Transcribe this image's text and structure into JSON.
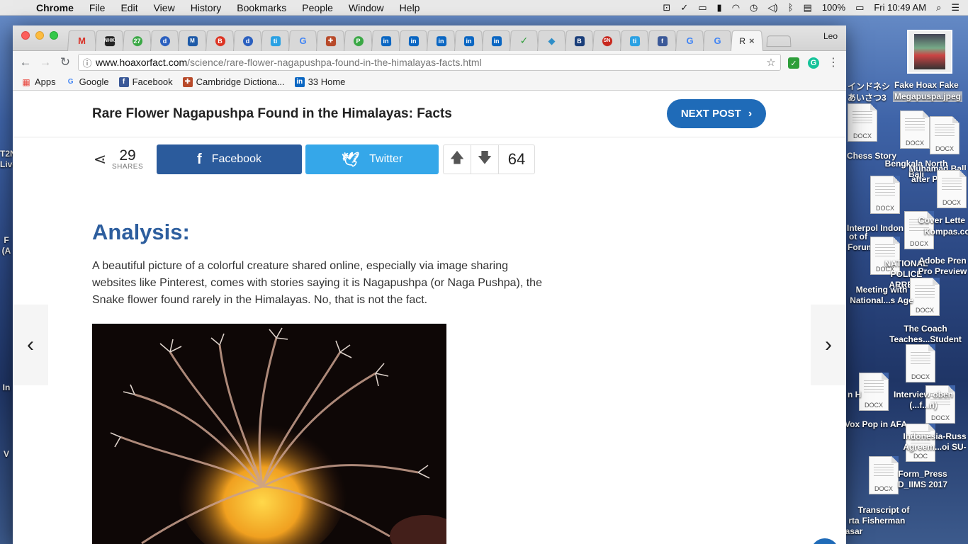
{
  "menubar": {
    "app": "Chrome",
    "menus": [
      "File",
      "Edit",
      "View",
      "History",
      "Bookmarks",
      "People",
      "Window",
      "Help"
    ],
    "battery": "100%",
    "clock": "Fri 10:49 AM"
  },
  "browser": {
    "active_tab": {
      "label": "R",
      "close": "×"
    },
    "profile": "Leo",
    "url": {
      "domain": "www.hoaxorfact.com",
      "path": "/science/rare-flower-nagapushpa-found-in-the-himalayas-facts.html"
    },
    "bookmarks": [
      "Apps",
      "Google",
      "Facebook",
      "Cambridge Dictiona...",
      "33 Home"
    ]
  },
  "page": {
    "sticky_title": "Rare Flower Nagapushpa Found in the Himalayas: Facts",
    "next_post": "NEXT POST",
    "shares": {
      "count": "29",
      "label": "SHARES"
    },
    "facebook": "Facebook",
    "twitter": "Twitter",
    "votes": "64",
    "heading": "Analysis:",
    "paragraph": "A beautiful picture of a colorful creature shared online, especially via image sharing websites like Pinterest, comes with stories saying it is Nagapushpa (or Naga Pushpa), the Snake flower found rarely in the Himalayas. No, that is not the fact."
  },
  "desktop": {
    "items": [
      "Fake Hoax Fake",
      "Megapuspa.jpeg",
      "インドネシ",
      "あいさつ3",
      "Chess Story",
      "Bengkala North Bali",
      "Muhamad Ball after Perfor...",
      "Interpol Indon",
      "ot of Forum",
      "Cover Lette",
      "Kompas.co",
      "NATIONAL POLICE ARREST",
      "Adobe Pren Pro Preview",
      "Meeting with National...s Age",
      "The Coach Teaches...Student",
      "n H",
      "Interview oben (...f...n)",
      "Vox Pop in AFA",
      "Indonesia-Russ Agreem...oi SU-",
      "Form_Press D_IIMS 2017",
      "Transcript of Fisherman",
      "rta asar",
      "T2N Live",
      "F (A",
      "In",
      "V"
    ],
    "doc_labels": [
      "DOC",
      "DOCX"
    ]
  },
  "colors": {
    "brand": "#1f6bb8",
    "heading": "#2d5e9e",
    "facebook": "#2b5b9c",
    "twitter": "#35a7e9"
  }
}
